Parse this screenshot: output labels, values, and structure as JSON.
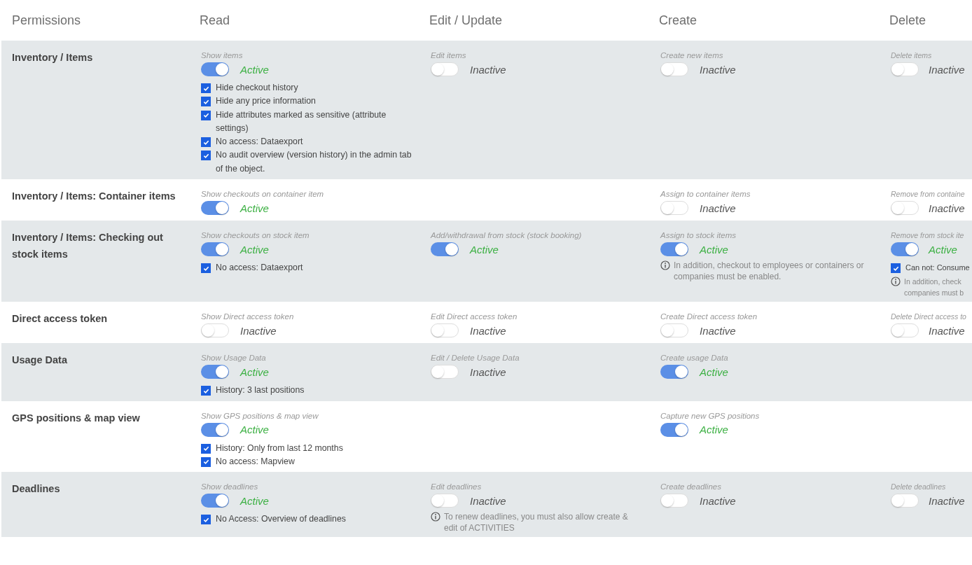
{
  "header": [
    "Permissions",
    "Read",
    "Edit / Update",
    "Create",
    "Delete"
  ],
  "rows": [
    {
      "label": "Inventory / Items",
      "cells": [
        {
          "label": "Show items",
          "on": true,
          "status": "Active",
          "options": [
            {
              "text": "Hide checkout history",
              "checked": true
            },
            {
              "text": "Hide any price information",
              "checked": true
            },
            {
              "text": "Hide attributes marked as sensitive (attribute settings)",
              "checked": true
            },
            {
              "text": "No access: Dataexport",
              "checked": true
            },
            {
              "text": "No audit overview (version history) in the admin tab of the object.",
              "checked": true
            }
          ]
        },
        {
          "label": "Edit items",
          "on": false,
          "status": "Inactive"
        },
        {
          "label": "Create new items",
          "on": false,
          "status": "Inactive"
        },
        {
          "label": "Delete items",
          "on": false,
          "status": "Inactive"
        }
      ]
    },
    {
      "label": "Inventory / Items: Container items",
      "cells": [
        {
          "label": "Show checkouts on container item",
          "on": true,
          "status": "Active"
        },
        null,
        {
          "label": "Assign to container items",
          "on": false,
          "status": "Inactive"
        },
        {
          "label": "Remove from containe",
          "on": false,
          "status": "Inactive"
        }
      ]
    },
    {
      "label": "Inventory / Items: Checking out stock items",
      "cells": [
        {
          "label": "Show checkouts on stock item",
          "on": true,
          "status": "Active",
          "options": [
            {
              "text": "No access: Dataexport",
              "checked": true
            }
          ]
        },
        {
          "label": "Add/withdrawal from stock (stock booking)",
          "on": true,
          "status": "Active"
        },
        {
          "label": "Assign to stock items",
          "on": true,
          "status": "Active",
          "notes": [
            {
              "lines": [
                "In addition, checkout to employees or containers or",
                "companies must be enabled."
              ]
            }
          ]
        },
        {
          "label": "Remove from stock ite",
          "on": true,
          "status": "Active",
          "options": [
            {
              "text": "Can not: Consume",
              "checked": true
            }
          ],
          "notes": [
            {
              "lines": [
                "In addition, check",
                "companies must b"
              ]
            }
          ]
        }
      ]
    },
    {
      "label": "Direct access token",
      "cells": [
        {
          "label": "Show Direct access token",
          "on": false,
          "status": "Inactive"
        },
        {
          "label": "Edit Direct access token",
          "on": false,
          "status": "Inactive"
        },
        {
          "label": "Create Direct access token",
          "on": false,
          "status": "Inactive"
        },
        {
          "label": "Delete Direct access to",
          "on": false,
          "status": "Inactive"
        }
      ]
    },
    {
      "label": "Usage Data",
      "cells": [
        {
          "label": "Show Usage Data",
          "on": true,
          "status": "Active",
          "options": [
            {
              "text": "History: 3 last positions",
              "checked": true
            }
          ]
        },
        {
          "label": "Edit / Delete Usage Data",
          "on": false,
          "status": "Inactive"
        },
        {
          "label": "Create usage Data",
          "on": true,
          "status": "Active"
        },
        null
      ]
    },
    {
      "label": "GPS positions & map view",
      "cells": [
        {
          "label": "Show GPS positions & map view",
          "on": true,
          "status": "Active",
          "options": [
            {
              "text": "History: Only from last 12 months",
              "checked": true
            },
            {
              "text": "No access: Mapview",
              "checked": true
            }
          ]
        },
        null,
        {
          "label": "Capture new GPS positions",
          "on": true,
          "status": "Active"
        },
        null
      ]
    },
    {
      "label": "Deadlines",
      "cells": [
        {
          "label": "Show deadlines",
          "on": true,
          "status": "Active",
          "options": [
            {
              "text": "No Access: Overview of deadlines",
              "checked": true
            }
          ]
        },
        {
          "label": "Edit deadlines",
          "on": false,
          "status": "Inactive",
          "notes": [
            {
              "lines": [
                "To renew deadlines, you must also allow create &",
                "edit of ACTIVITIES"
              ]
            }
          ]
        },
        {
          "label": "Create deadlines",
          "on": false,
          "status": "Inactive"
        },
        {
          "label": "Delete deadlines",
          "on": false,
          "status": "Inactive"
        }
      ]
    }
  ]
}
